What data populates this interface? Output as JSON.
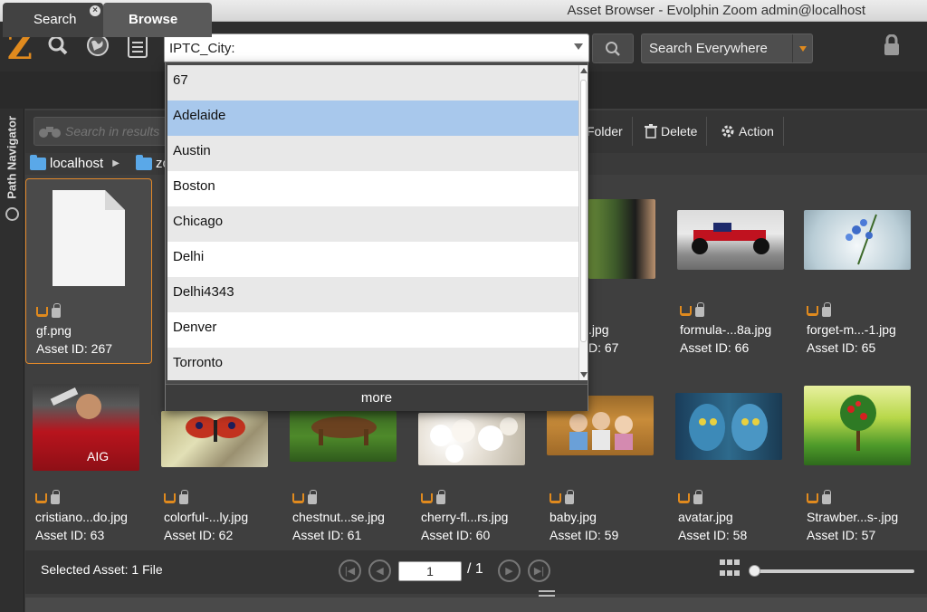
{
  "window": {
    "title": "Asset Browser - Evolphin Zoom admin@localhost",
    "traffic_colors": [
      "#ff5f57",
      "#febc2e",
      "#28c840"
    ]
  },
  "toolbar": {
    "logo": "Z",
    "icons": [
      "magnifier-icon",
      "globe-icon",
      "clipboard-list-icon"
    ],
    "search_value": "IPTC_City:",
    "scope_value": "Search Everywhere",
    "accent": "#e08a1e"
  },
  "tabs": {
    "search": "Search",
    "browse": "Browse"
  },
  "side_nav": {
    "label": "Path Navigator"
  },
  "actions": {
    "search_placeholder": "Search in results",
    "folder": "Folder",
    "delete": "Delete",
    "action": "Action"
  },
  "breadcrumb": {
    "root": "localhost",
    "child": "zo"
  },
  "assets": [
    {
      "name": "gf.png",
      "id": "Asset ID: 267",
      "thumb": "file"
    },
    {
      "name": ".jpg",
      "id": "D: 67",
      "thumb": "harry"
    },
    {
      "name": "formula-...8a.jpg",
      "id": "Asset ID: 66",
      "thumb": "formula"
    },
    {
      "name": "forget-m...-1.jpg",
      "id": "Asset ID: 65",
      "thumb": "flower-glass"
    },
    {
      "name": "cristiano...do.jpg",
      "id": "Asset ID: 63",
      "thumb": "cristiano"
    },
    {
      "name": "colorful-...ly.jpg",
      "id": "Asset ID: 62",
      "thumb": "butterfly"
    },
    {
      "name": "chestnut...se.jpg",
      "id": "Asset ID: 61",
      "thumb": "horse"
    },
    {
      "name": "cherry-fl...rs.jpg",
      "id": "Asset ID: 60",
      "thumb": "cherry"
    },
    {
      "name": "baby.jpg",
      "id": "Asset ID: 59",
      "thumb": "baby"
    },
    {
      "name": "avatar.jpg",
      "id": "Asset ID: 58",
      "thumb": "avatar"
    },
    {
      "name": "Strawber...s-.jpg",
      "id": "Asset ID: 57",
      "thumb": "strawberry"
    }
  ],
  "status": {
    "selected": "Selected Asset: 1 File",
    "page_value": "1",
    "page_total": "/ 1"
  },
  "dropdown": {
    "items": [
      "67",
      "Adelaide",
      "Austin",
      "Boston",
      "Chicago",
      "Delhi",
      "Delhi4343",
      "Denver",
      "Torronto"
    ],
    "highlighted": "Adelaide",
    "more_label": "more"
  }
}
